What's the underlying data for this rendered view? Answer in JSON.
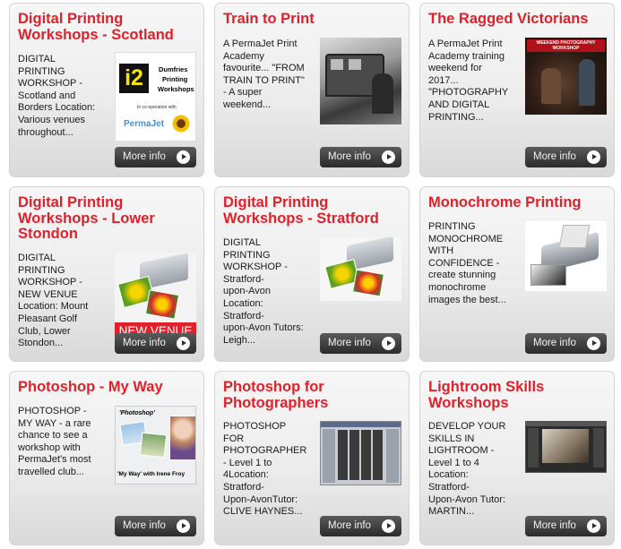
{
  "more_info_label": "More info",
  "cards": [
    {
      "title": "Digital Printing Workshops - Scotland",
      "desc": "DIGITAL\nPRINTING\nWORKSHOP -\nScotland and\nBorders Location:\nVarious venues\nthroughout...",
      "thumb": {
        "logo_mark": "i2",
        "logo_lines": [
          "Dumfries",
          "Printing",
          "Workshops"
        ],
        "coop": "In co-operation with",
        "brand": "PermaJet"
      }
    },
    {
      "title": "Train to Print",
      "desc": "A PermaJet Print\nAcademy\nfavourite... \"FROM\nTRAIN TO PRINT\"\n- A super\nweekend...",
      "thumb": {}
    },
    {
      "title": "The Ragged Victorians",
      "desc": "A PermaJet Print\nAcademy training\nweekend for\n2017...\n\"PHOTOGRAPHY\nAND DIGITAL\nPRINTING...",
      "thumb": {
        "banner": "WEEKEND PHOTOGRAPHY WORKSHOP"
      }
    },
    {
      "title": "Digital Printing Workshops - Lower Stondon",
      "desc": "DIGITAL\nPRINTING\nWORKSHOP -\nNEW VENUE\nLocation: Mount\nPleasant Golf\nClub, Lower\nStondon...",
      "thumb": {
        "badge": "NEW VENUE"
      }
    },
    {
      "title": "Digital Printing Workshops - Stratford",
      "desc": "DIGITAL\nPRINTING\nWORKSHOP -\nStratford-\nupon-Avon\nLocation:\nStratford-\nupon-Avon Tutors:\nLeigh...",
      "thumb": {}
    },
    {
      "title": "Monochrome Printing",
      "desc": "PRINTING\nMONOCHROME\nWITH\nCONFIDENCE -\ncreate stunning\nmonochrome\nimages the best...",
      "thumb": {}
    },
    {
      "title": "Photoshop - My Way",
      "desc": "PHOTOSHOP -\nMY WAY - a rare\nchance to see a\nworkshop with\nPermaJet's most\ntravelled club...",
      "thumb": {
        "top": "'Photoshop'",
        "bottom": "'My Way' with Irene Froy"
      }
    },
    {
      "title": "Photoshop for Photographers",
      "desc": "PHOTOSHOP\nFOR\nPHOTOGRAPHER\n- Level 1 to\n4Location:\nStratford-\nUpon-AvonTutor:\nCLIVE HAYNES...",
      "thumb": {}
    },
    {
      "title": "Lightroom Skills Workshops",
      "desc": "DEVELOP YOUR\nSKILLS IN\nLIGHTROOM -\nLevel 1 to 4\nLocation:\nStratford-\nUpon-Avon Tutor:\nMARTIN...",
      "thumb": {}
    }
  ]
}
